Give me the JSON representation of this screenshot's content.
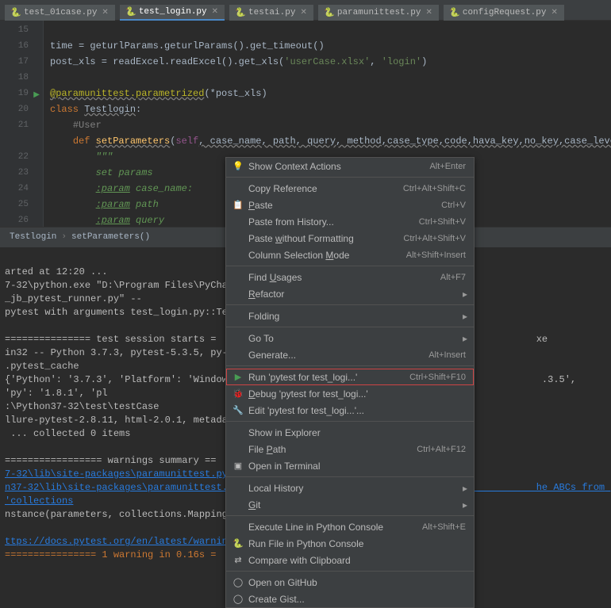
{
  "tabs": [
    {
      "name": "test_01case.py",
      "active": false
    },
    {
      "name": "test_login.py",
      "active": true
    },
    {
      "name": "testai.py",
      "active": false
    },
    {
      "name": "paramunittest.py",
      "active": false
    },
    {
      "name": "configRequest.py",
      "active": false
    }
  ],
  "gutter": [
    "15",
    "16",
    "17",
    "18",
    "19",
    "20",
    "21",
    " ",
    "22",
    "23",
    "24",
    "25",
    "26"
  ],
  "code": {
    "l15": "time = geturlParams.geturlParams().get_timeout()",
    "l16_a": "post_xls = readExcel.readExcel().get_xls(",
    "l16_s1": "'userCase.xlsx'",
    "l16_c": ", ",
    "l16_s2": "'login'",
    "l16_e": ")",
    "l18_deco": "@paramunittest.parametrized",
    "l18_rest": "(*post_xls)",
    "l19_kw": "class ",
    "l19_name": "Testlogin",
    "l19_colon": ":",
    "l20_comment": "#User",
    "l21_kw": "def ",
    "l21_name": "setParameters",
    "l21_p": "(",
    "l21_self": "self",
    "l21_rest": ", case_name, path, query, method,case_type,code,hava_key,no_key,case_level)",
    "l22": "\"\"\"",
    "l23": "set params",
    "l24a": ":param",
    "l24b": " case_name:",
    "l25a": ":param",
    "l25b": " path",
    "l26a": ":param",
    "l26b": " query"
  },
  "breadcrumb": {
    "a": "Testlogin",
    "b": "setParameters()"
  },
  "menu": {
    "showContext": "Show Context Actions",
    "showContext_k": "Alt+Enter",
    "copyRef": "Copy Reference",
    "copyRef_k": "Ctrl+Alt+Shift+C",
    "paste": "Paste",
    "paste_k": "Ctrl+V",
    "pasteHist": "Paste from History...",
    "pasteHist_k": "Ctrl+Shift+V",
    "pasteNoFmt": "Paste without Formatting",
    "pasteNoFmt_k": "Ctrl+Alt+Shift+V",
    "colSel": "Column Selection Mode",
    "colSel_k": "Alt+Shift+Insert",
    "findU": "Find Usages",
    "findU_k": "Alt+F7",
    "refactor": "Refactor",
    "folding": "Folding",
    "goto": "Go To",
    "generate": "Generate...",
    "generate_k": "Alt+Insert",
    "run": "Run 'pytest for test_logi...'",
    "run_k": "Ctrl+Shift+F10",
    "debug": "Debug 'pytest for test_logi...'",
    "edit": "Edit 'pytest for test_logi...'...",
    "showExp": "Show in Explorer",
    "filePath": "File Path",
    "filePath_k": "Ctrl+Alt+F12",
    "openTerm": "Open in Terminal",
    "localHist": "Local History",
    "git": "Git",
    "execLine": "Execute Line in Python Console",
    "execLine_k": "Alt+Shift+E",
    "runFile": "Run File in Python Console",
    "compare": "Compare with Clipboard",
    "openGH": "Open on GitHub",
    "gist": "Create Gist..."
  },
  "output": {
    "l1": "arted at 12:20 ...",
    "l2": "7-32\\python.exe \"D:\\Program Files\\PyCharm                                                    _jb_pytest_runner.py\" --",
    "l3": "pytest with arguments test_login.py::Test",
    "l4": "",
    "l5": "=============== test session starts =                                                        xe",
    "l6": "in32 -- Python 3.7.3, pytest-5.3.5, py-1.",
    "l7": ".pytest_cache",
    "l8": "{'Python': '3.7.3', 'Platform': 'Windows-                                                     .3.5', 'py': '1.8.1', 'pl",
    "l9": ":\\Python37-32\\test\\testCase",
    "l10": "llure-pytest-2.8.11, html-2.0.1, metadata",
    "l11": " ... collected 0 items",
    "l12": "",
    "l13": "================= warnings summary ==",
    "l14": "7-32\\lib\\site-packages\\paramunittest.py:1",
    "l15": "n37-32\\lib\\site-packages\\paramunittest.py:                                                   he ABCs from 'collections",
    "l16": "nstance(parameters, collections.Mapping):",
    "l17": "",
    "l18": "ttps://docs.pytest.org/en/latest/warnings.html",
    "l19": "================ 1 warning in 0.16s ="
  }
}
